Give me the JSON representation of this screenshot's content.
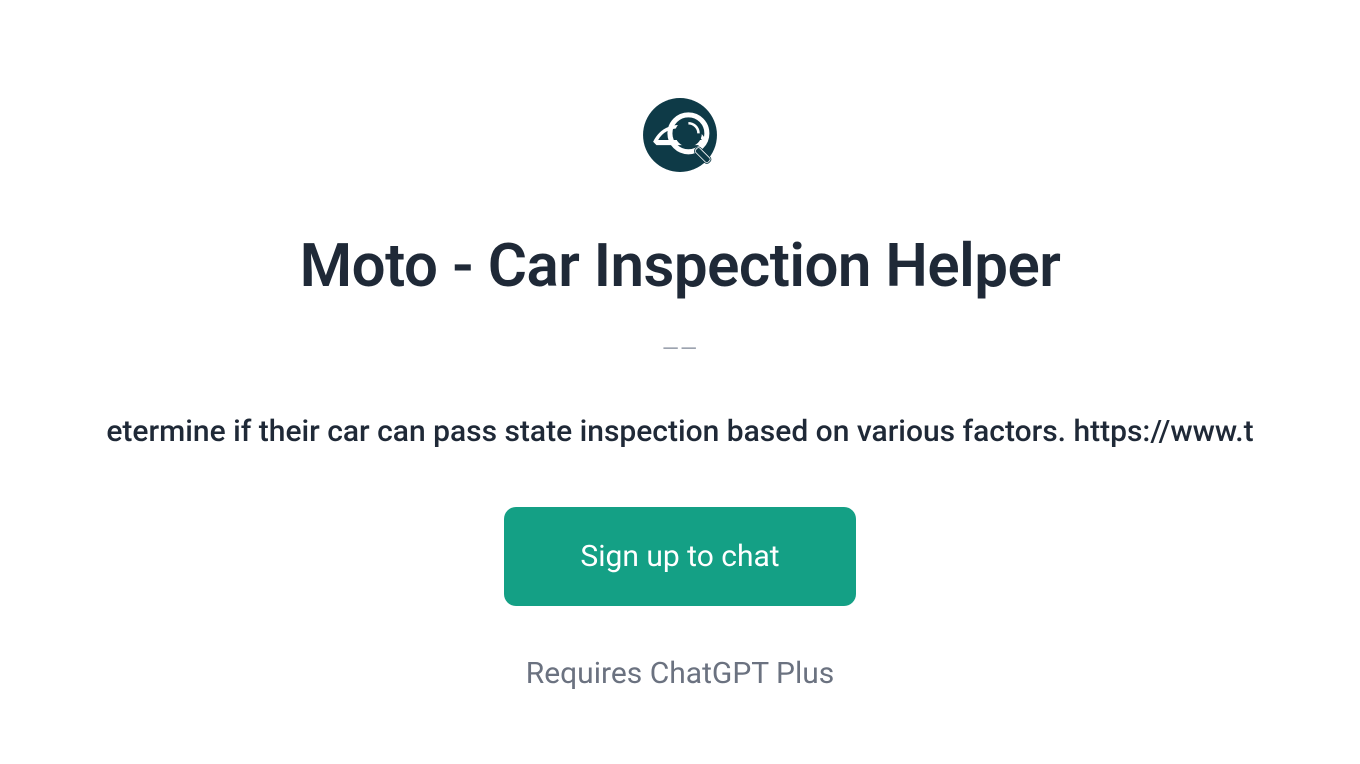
{
  "title": "Moto - Car Inspection Helper",
  "separator": "——",
  "description": "etermine if their car can pass state inspection based on various factors. https://www.t",
  "signup_button": "Sign up to chat",
  "requires_text": "Requires ChatGPT Plus"
}
